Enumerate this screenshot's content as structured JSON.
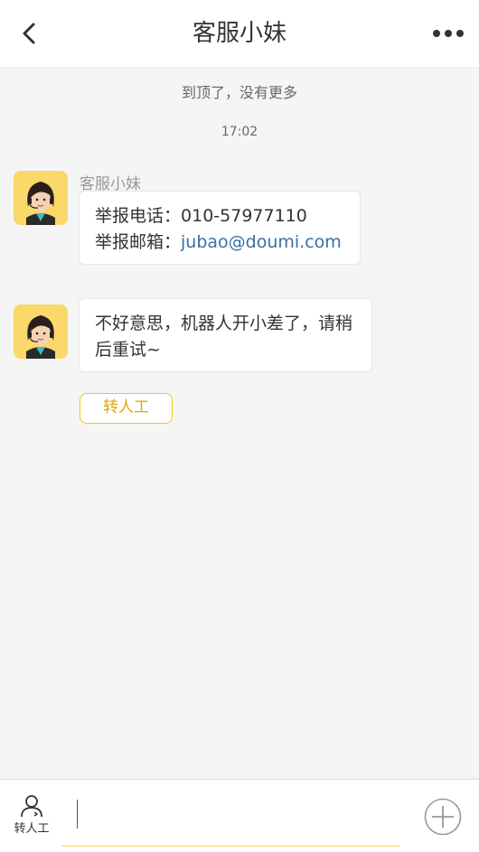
{
  "header": {
    "title": "客服小妹",
    "back_icon": "chevron-left-icon",
    "more_icon": "more-horizontal-icon"
  },
  "chat": {
    "top_note": "到顶了，没有更多",
    "timestamp": "17:02",
    "sender_name": "客服小妹",
    "messages": [
      {
        "line1_label": "举报电话：",
        "line1_value": "010-57977110",
        "line2_label": "举报邮箱：",
        "line2_value": "jubao@doumi.com"
      },
      {
        "text": "不好意思，机器人开小差了，请稍后重试~"
      }
    ],
    "transfer_button": "转人工"
  },
  "bottom_bar": {
    "human_label": "转人工",
    "human_icon": "person-icon",
    "input_value": "",
    "plus_icon": "plus-circle-icon"
  },
  "colors": {
    "accent": "#f5c518",
    "link": "#3a6ea5",
    "avatar_bg": "#fad86a",
    "page_bg": "#f5f5f5"
  }
}
